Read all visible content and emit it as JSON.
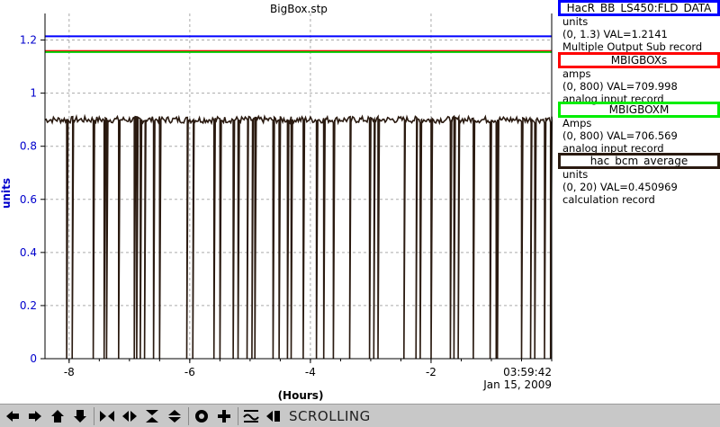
{
  "chart_data": {
    "type": "line",
    "title": "BigBox.stp",
    "ylabel": "units",
    "xlabel": "(Hours)",
    "ylim": [
      0,
      1.3
    ],
    "xlim": [
      -8.4,
      0
    ],
    "y_ticks": [
      0,
      0.2,
      0.4,
      0.6,
      0.8,
      1,
      1.2
    ],
    "y_tick_labels": [
      "0",
      "0.2",
      "0.4",
      "0.6",
      "0.8",
      "1",
      "1.2"
    ],
    "x_ticks": [
      -8,
      -6,
      -4,
      -2
    ],
    "x_tick_labels": [
      "-8",
      "-6",
      "-4",
      "-2"
    ],
    "end_time": "03:59:42",
    "end_date": "Jan 15, 2009",
    "grid": true,
    "series": [
      {
        "name": "HacR_BB_LS450:FLD_DATA",
        "color": "#0000ff",
        "constant": 1.2141
      },
      {
        "name": "MBIGBOXs",
        "color": "#ff0000",
        "constant": 1.1588
      },
      {
        "name": "MBIGBOXM",
        "color": "#00cc00",
        "constant": 1.1548
      },
      {
        "name": "hac_bcm_average",
        "color": "#2a1a10",
        "baseline": 0.9,
        "dropouts": [
          -8.04,
          -7.95,
          -7.6,
          -7.42,
          -7.38,
          -7.18,
          -6.92,
          -6.88,
          -6.82,
          -6.75,
          -6.6,
          -6.5,
          -6.05,
          -5.95,
          -5.6,
          -5.5,
          -5.28,
          -5.2,
          -5.05,
          -4.97,
          -4.92,
          -4.62,
          -4.52,
          -4.38,
          -4.32,
          -4.12,
          -3.9,
          -3.78,
          -3.62,
          -3.35,
          -3.02,
          -2.95,
          -2.88,
          -2.45,
          -2.25,
          -2.18,
          -2.0,
          -1.68,
          -1.62,
          -1.55,
          -1.3,
          -1.02,
          -0.92,
          -0.9,
          -0.5,
          -0.35,
          -0.28,
          -0.12,
          -0.02
        ]
      }
    ]
  },
  "legend": [
    {
      "name": "HacR_BB_LS450:FLD_DATA",
      "color": "#0000ff",
      "units": "units",
      "range_val": "(0, 1.3) VAL=1.2141",
      "record": "Multiple Output Sub record"
    },
    {
      "name": "MBIGBOXs",
      "color": "#ff0000",
      "units": "amps",
      "range_val": "(0, 800) VAL=709.998",
      "record": "analog input record"
    },
    {
      "name": "MBIGBOXM",
      "color": "#00ee00",
      "units": "Amps",
      "range_val": "(0, 800) VAL=706.569",
      "record": "analog input record"
    },
    {
      "name": "hac_bcm_average",
      "color": "#2a1a10",
      "units": "units",
      "range_val": "(0, 20) VAL=0.450969",
      "record": "calculation record"
    }
  ],
  "toolbar": {
    "buttons": [
      "left-arrow-icon",
      "right-arrow-icon",
      "up-arrow-icon",
      "down-arrow-icon",
      "zoom-in-horizontal-icon",
      "zoom-out-horizontal-icon",
      "zoom-in-vertical-icon",
      "zoom-out-vertical-icon",
      "stop-icon",
      "add-icon",
      "autoscale-icon",
      "export-icon"
    ],
    "mode_label": "SCROLLING"
  }
}
